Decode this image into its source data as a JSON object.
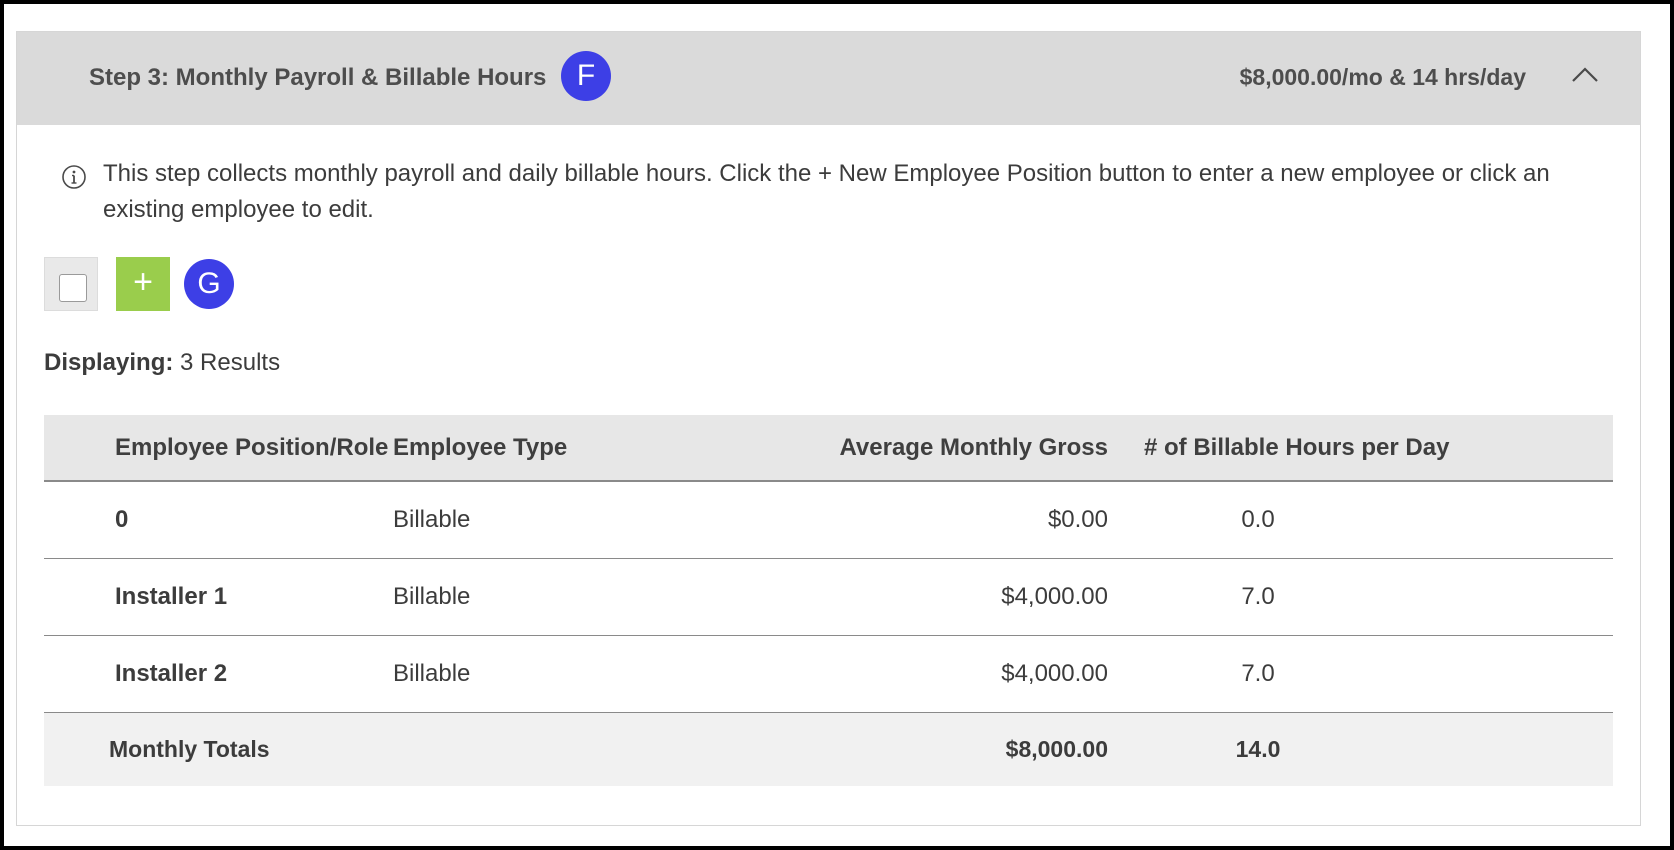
{
  "step": {
    "title": "Step 3: Monthly Payroll & Billable Hours",
    "marker": "F",
    "summary": "$8,000.00/mo & 14 hrs/day"
  },
  "info": {
    "icon": "info-icon",
    "text": "This step collects monthly payroll and daily billable hours. Click the + New Employee Position button to enter a new employee or click an existing employee to edit."
  },
  "toolbar": {
    "add_label": "+",
    "marker": "G"
  },
  "results": {
    "label": "Displaying:",
    "count_text": "3 Results"
  },
  "table": {
    "headers": {
      "role": "Employee Position/Role",
      "type": "Employee Type",
      "gross": "Average Monthly Gross",
      "hours": "# of Billable Hours per Day"
    },
    "rows": [
      {
        "role": "0",
        "type": "Billable",
        "gross": "$0.00",
        "hours": "0.0"
      },
      {
        "role": "Installer 1",
        "type": "Billable",
        "gross": "$4,000.00",
        "hours": "7.0"
      },
      {
        "role": "Installer 2",
        "type": "Billable",
        "gross": "$4,000.00",
        "hours": "7.0"
      }
    ],
    "totals": {
      "label": "Monthly Totals",
      "gross": "$8,000.00",
      "hours": "14.0"
    }
  },
  "colors": {
    "header_bg": "#dadada",
    "marker_blue": "#3d3fe6",
    "add_green": "#9acd4c"
  }
}
